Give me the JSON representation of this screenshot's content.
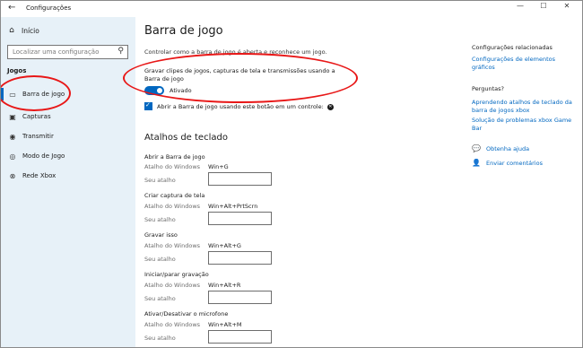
{
  "window": {
    "title": "Configurações",
    "back_glyph": "←",
    "controls": {
      "minimize": "—",
      "maximize": "☐",
      "close": "✕"
    }
  },
  "sidebar": {
    "home_label": "Início",
    "search_placeholder": "Localizar uma configuração",
    "section": "Jogos",
    "items": [
      {
        "label": "Barra de jogo",
        "icon": "game-bar-icon",
        "active": true
      },
      {
        "label": "Capturas",
        "icon": "capture-icon",
        "active": false
      },
      {
        "label": "Transmitir",
        "icon": "broadcast-icon",
        "active": false
      },
      {
        "label": "Modo de Jogo",
        "icon": "game-mode-icon",
        "active": false
      },
      {
        "label": "Rede Xbox",
        "icon": "xbox-network-icon",
        "active": false
      }
    ]
  },
  "main": {
    "title": "Barra de jogo",
    "description": "Controlar como a barra de jogo é aberta e reconhece um jogo.",
    "record_option": "Gravar clipes de jogos, capturas de tela e transmissões usando a Barra de jogo",
    "toggle_state": "Ativado",
    "controller_checkbox": "Abrir a Barra de jogo usando este botão em um controle:",
    "shortcuts_title": "Atalhos de teclado",
    "windows_shortcut_label": "Atalho do Windows",
    "your_shortcut_label": "Seu atalho",
    "shortcuts": [
      {
        "name": "Abrir a Barra de jogo",
        "windows": "Win+G",
        "custom": ""
      },
      {
        "name": "Criar captura de tela",
        "windows": "Win+Alt+PrtScrn",
        "custom": ""
      },
      {
        "name": "Gravar isso",
        "windows": "Win+Alt+G",
        "custom": ""
      },
      {
        "name": "Iniciar/parar gravação",
        "windows": "Win+Alt+R",
        "custom": ""
      },
      {
        "name": "Ativar/Desativar o microfone",
        "windows": "Win+Alt+M",
        "custom": ""
      }
    ]
  },
  "right": {
    "related_heading": "Configurações relacionadas",
    "related_link": "Configurações de elementos gráficos",
    "questions_heading": "Perguntas?",
    "link_shortcuts": "Aprendendo atalhos de teclado da barra de jogos xbox",
    "link_troubleshoot": "Solução de problemas xbox Game Bar",
    "get_help": "Obtenha ajuda",
    "feedback": "Enviar comentários"
  },
  "colors": {
    "accent": "#0067c0",
    "sidebar_bg": "#e7f1f8",
    "annotation": "#e81717"
  }
}
